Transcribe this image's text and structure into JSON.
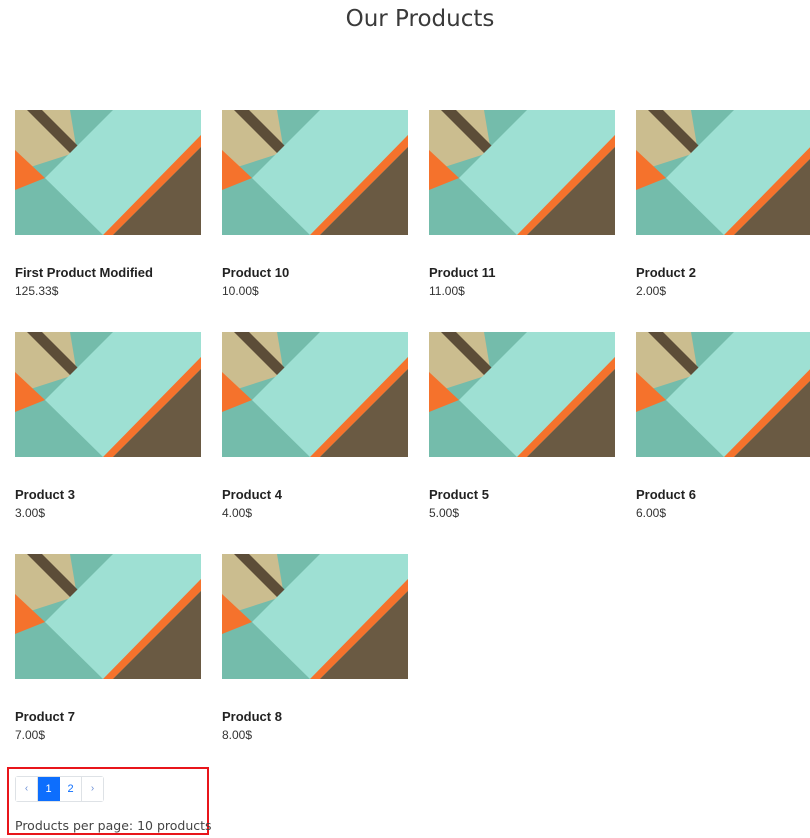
{
  "page": {
    "title": "Our Products"
  },
  "colors": {
    "teal_dark": "#74bcab",
    "teal_light": "#9ee0d3",
    "tan": "#cbbd8f",
    "orange": "#f5722c",
    "brown": "#6a5a43",
    "accent_blue": "#0d6efd",
    "highlight_red": "#e8151b"
  },
  "products": [
    {
      "name": "First Product Modified",
      "price": "125.33$",
      "image": "material-abstract-image"
    },
    {
      "name": "Product 10",
      "price": "10.00$",
      "image": "material-abstract-image"
    },
    {
      "name": "Product 11",
      "price": "11.00$",
      "image": "material-abstract-image"
    },
    {
      "name": "Product 2",
      "price": "2.00$",
      "image": "material-abstract-image"
    },
    {
      "name": "Product 3",
      "price": "3.00$",
      "image": "material-abstract-image"
    },
    {
      "name": "Product 4",
      "price": "4.00$",
      "image": "material-abstract-image"
    },
    {
      "name": "Product 5",
      "price": "5.00$",
      "image": "material-abstract-image"
    },
    {
      "name": "Product 6",
      "price": "6.00$",
      "image": "material-abstract-image"
    },
    {
      "name": "Product 7",
      "price": "7.00$",
      "image": "material-abstract-image"
    },
    {
      "name": "Product 8",
      "price": "8.00$",
      "image": "material-abstract-image"
    }
  ],
  "pagination": {
    "prev_label": "‹",
    "pages": [
      "1",
      "2"
    ],
    "current_page": "1",
    "next_label": "›"
  },
  "per_page_text": "Products per page: 10 products"
}
